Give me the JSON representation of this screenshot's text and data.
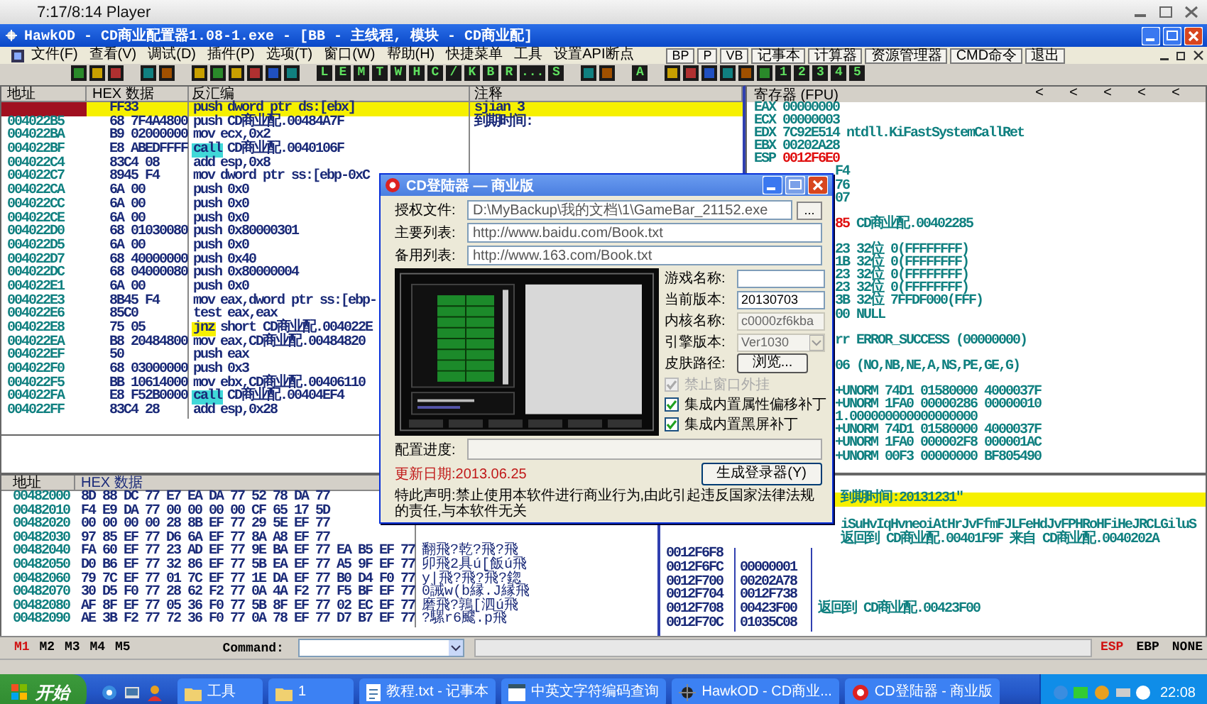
{
  "player": {
    "title": "7:17/8:14 Player"
  },
  "window": {
    "title": "HawkOD - CD商业配置器1.08-1.exe - [BB - 主线程, 模块 - CD商业配]"
  },
  "menu": [
    "文件(F)",
    "查看(V)",
    "调试(D)",
    "插件(P)",
    "选项(T)",
    "窗口(W)",
    "帮助(H)",
    "快捷菜单",
    "工具",
    "设置API断点"
  ],
  "tool_buttons": [
    "BP",
    "P",
    "VB",
    "记事本",
    "计算器",
    "资源管理器",
    "CMD命令",
    "退出"
  ],
  "toolbar": [
    {
      "kind": "icon"
    },
    {
      "kind": "icon"
    },
    {
      "kind": "icon"
    },
    {
      "kind": "gap"
    },
    {
      "kind": "icon"
    },
    {
      "kind": "icon"
    },
    {
      "kind": "gap"
    },
    {
      "kind": "icon"
    },
    {
      "kind": "icon"
    },
    {
      "kind": "icon"
    },
    {
      "kind": "icon"
    },
    {
      "kind": "icon"
    },
    {
      "kind": "icon"
    },
    {
      "kind": "gap"
    },
    {
      "kind": "letter",
      "label": "L"
    },
    {
      "kind": "letter",
      "label": "E"
    },
    {
      "kind": "letter",
      "label": "M"
    },
    {
      "kind": "letter",
      "label": "T"
    },
    {
      "kind": "letter",
      "label": "W"
    },
    {
      "kind": "letter",
      "label": "H"
    },
    {
      "kind": "letter",
      "label": "C"
    },
    {
      "kind": "letter",
      "label": "/"
    },
    {
      "kind": "letter",
      "label": "K"
    },
    {
      "kind": "letter",
      "label": "B"
    },
    {
      "kind": "letter",
      "label": "R"
    },
    {
      "kind": "letter",
      "label": "..."
    },
    {
      "kind": "letter",
      "label": "S"
    },
    {
      "kind": "gap"
    },
    {
      "kind": "icon"
    },
    {
      "kind": "icon"
    },
    {
      "kind": "gap"
    },
    {
      "kind": "letter",
      "label": "A"
    },
    {
      "kind": "gap"
    },
    {
      "kind": "icon"
    },
    {
      "kind": "icon"
    },
    {
      "kind": "icon"
    },
    {
      "kind": "icon"
    },
    {
      "kind": "icon"
    },
    {
      "kind": "icon"
    },
    {
      "kind": "letter",
      "label": "1"
    },
    {
      "kind": "letter",
      "label": "2"
    },
    {
      "kind": "letter",
      "label": "3"
    },
    {
      "kind": "letter",
      "label": "4"
    },
    {
      "kind": "letter",
      "label": "5"
    }
  ],
  "disassembly": {
    "columns": [
      "地址",
      "HEX 数据",
      "反汇编",
      "注释"
    ],
    "rows": [
      {
        "hex": "FF33",
        "op": "push",
        "args": "dword ptr ds:[ebx]",
        "kind": "plain",
        "comment": "sjian  3",
        "selected": true,
        "current": true
      },
      {
        "address": "004022B5",
        "hex": "68 7F4A4800",
        "op": "push",
        "args": "CD商业配.00484A7F",
        "kind": "plain",
        "comment": "到期时间:",
        "selected": false,
        "current": false
      },
      {
        "address": "004022BA",
        "hex": "B9 02000000",
        "op": "mov",
        "args": "ecx,0x2",
        "kind": "plain",
        "selected": false,
        "current": false
      },
      {
        "address": "004022BF",
        "hex": "E8 ABEDFFFF",
        "op": "call",
        "args": "CD商业配.0040106F",
        "kind": "call",
        "selected": false,
        "current": false
      },
      {
        "address": "004022C4",
        "hex": "83C4 08",
        "op": "add",
        "args": "esp,0x8",
        "kind": "plain",
        "selected": false,
        "current": false
      },
      {
        "address": "004022C7",
        "hex": "8945 F4",
        "op": "mov",
        "args": "dword ptr ss:[ebp-0xC",
        "kind": "plain",
        "selected": false,
        "current": false
      },
      {
        "address": "004022CA",
        "hex": "6A 00",
        "op": "push",
        "args": "0x0",
        "kind": "plain",
        "selected": false,
        "current": false
      },
      {
        "address": "004022CC",
        "hex": "6A 00",
        "op": "push",
        "args": "0x0",
        "kind": "plain",
        "selected": false,
        "current": false
      },
      {
        "address": "004022CE",
        "hex": "6A 00",
        "op": "push",
        "args": "0x0",
        "kind": "plain",
        "selected": false,
        "current": false
      },
      {
        "address": "004022D0",
        "hex": "68 01030080",
        "op": "push",
        "args": "0x80000301",
        "kind": "plain",
        "selected": false,
        "current": false
      },
      {
        "address": "004022D5",
        "hex": "6A 00",
        "op": "push",
        "args": "0x0",
        "kind": "plain",
        "selected": false,
        "current": false
      },
      {
        "address": "004022D7",
        "hex": "68 40000000",
        "op": "push",
        "args": "0x40",
        "kind": "plain",
        "selected": false,
        "current": false
      },
      {
        "address": "004022DC",
        "hex": "68 04000080",
        "op": "push",
        "args": "0x80000004",
        "kind": "plain",
        "selected": false,
        "current": false
      },
      {
        "address": "004022E1",
        "hex": "6A 00",
        "op": "push",
        "args": "0x0",
        "kind": "plain",
        "selected": false,
        "current": false
      },
      {
        "address": "004022E3",
        "hex": "8B45 F4",
        "op": "mov",
        "args": "eax,dword ptr ss:[ebp-",
        "kind": "plain",
        "selected": false,
        "current": false
      },
      {
        "address": "004022E6",
        "hex": "85C0",
        "op": "test",
        "args": "eax,eax",
        "kind": "plain",
        "selected": false,
        "current": false
      },
      {
        "address": "004022E8",
        "hex": "75 05",
        "op": "jnz",
        "args": "short CD商业配.004022E",
        "kind": "jump",
        "selected": false,
        "current": false
      },
      {
        "address": "004022EA",
        "hex": "B8 20484800",
        "op": "mov",
        "args": "eax,CD商业配.00484820",
        "kind": "plain",
        "selected": false,
        "current": false
      },
      {
        "address": "004022EF",
        "hex": "50",
        "op": "push",
        "args": "eax",
        "kind": "plain",
        "selected": false,
        "current": false
      },
      {
        "address": "004022F0",
        "hex": "68 03000000",
        "op": "push",
        "args": "0x3",
        "kind": "plain",
        "selected": false,
        "current": false
      },
      {
        "address": "004022F5",
        "hex": "BB 10614000",
        "op": "mov",
        "args": "ebx,CD商业配.00406110",
        "kind": "plain",
        "selected": false,
        "current": false
      },
      {
        "address": "004022FA",
        "hex": "E8 F52B0000",
        "op": "call",
        "args": "CD商业配.00404EF4",
        "kind": "call",
        "selected": false,
        "current": false
      },
      {
        "address": "004022FF",
        "hex": "83C4 28",
        "op": "add",
        "args": "esp,0x28",
        "kind": "plain",
        "selected": false,
        "current": false
      }
    ]
  },
  "registers": {
    "title": "寄存器 (FPU)",
    "header_buttons": [
      "<",
      "<",
      "<",
      "<",
      "<"
    ],
    "lines": [
      {
        "kind": "full",
        "name": "EAX",
        "value": "00000000",
        "alert": false
      },
      {
        "kind": "full",
        "name": "ECX",
        "value": "00000003",
        "alert": false
      },
      {
        "kind": "full",
        "name": "EDX",
        "value": "7C92E514",
        "note": "ntdll.KiFastSystemCallRet",
        "alert": false
      },
      {
        "kind": "full",
        "name": "EBX",
        "value": "00202A28",
        "alert": false
      },
      {
        "kind": "full",
        "name": "ESP",
        "value": "0012F6E0",
        "alert": true
      },
      {
        "kind": "covered",
        "value": "F4",
        "alert": false
      },
      {
        "kind": "covered",
        "value": "76",
        "alert": false
      },
      {
        "kind": "covered",
        "value": "07",
        "alert": false
      },
      {
        "kind": "gap"
      },
      {
        "kind": "covered",
        "value": "85",
        "note": "CD商业配.00402285",
        "alert": true
      },
      {
        "kind": "gap"
      },
      {
        "kind": "covered",
        "value": "23",
        "note": "32位  0(FFFFFFFF)",
        "alert": false
      },
      {
        "kind": "covered",
        "value": "1B",
        "note": "32位  0(FFFFFFFF)",
        "alert": false
      },
      {
        "kind": "covered",
        "value": "23",
        "note": "32位  0(FFFFFFFF)",
        "alert": false
      },
      {
        "kind": "covered",
        "value": "23",
        "note": "32位  0(FFFFFFFF)",
        "alert": false
      },
      {
        "kind": "covered",
        "value": "3B",
        "note": "32位  7FFDF000(FFF)",
        "alert": false
      },
      {
        "kind": "covered",
        "value": "00",
        "note": "NULL",
        "alert": false
      },
      {
        "kind": "gap"
      },
      {
        "kind": "covered",
        "value": "rr",
        "note": "ERROR_SUCCESS (00000000)",
        "alert": false
      },
      {
        "kind": "gap"
      },
      {
        "kind": "covered",
        "value": "06",
        "note": "(NO,NB,NE,A,NS,PE,GE,G)",
        "alert": false
      },
      {
        "kind": "gap"
      },
      {
        "kind": "covered",
        "value": "+UNORM",
        "note": "74D1 01580000 4000037F",
        "alert": false
      },
      {
        "kind": "covered",
        "value": "+UNORM",
        "note": "1FA0 00000286 00000010",
        "alert": false
      },
      {
        "kind": "covered",
        "value": "1.000000000000000000",
        "alert": false
      },
      {
        "kind": "covered",
        "value": "+UNORM",
        "note": "74D1 01580000 4000037F",
        "alert": false
      },
      {
        "kind": "covered",
        "value": "+UNORM",
        "note": "1FA0 000002F8 000001AC",
        "alert": false
      },
      {
        "kind": "covered",
        "value": "+UNORM",
        "note": "00F3 00000000 BF805490",
        "alert": false
      }
    ]
  },
  "dump": {
    "columns": [
      "地址",
      "HEX 数据"
    ],
    "rows": [
      {
        "address": "00482000",
        "hex": "8D 88 DC 77 E7 EA DA 77 52 78 DA 77"
      },
      {
        "address": "00482010",
        "hex": "F4 E9 DA 77 00 00 00 00 CF 65 17 5D"
      },
      {
        "address": "00482020",
        "hex": "00 00 00 00 28 8B EF 77 29 5E EF 77"
      },
      {
        "address": "00482030",
        "hex": "97 85 EF 77 D6 6A EF 77 8A A8 EF 77"
      },
      {
        "address": "00482040",
        "hex": "FA 60 EF 77 23 AD EF 77 9E BA EF 77 EA B5 EF 77",
        "ascii": "翻飛?乾?飛?飛"
      },
      {
        "address": "00482050",
        "hex": "D0 B6 EF 77 32 86 EF 77 5B EA EF 77 A5 9F EF 77",
        "ascii": "卯飛2具ú[飯ú飛"
      },
      {
        "address": "00482060",
        "hex": "79 7C EF 77 01 7C EF 77 1E DA EF 77 B0 D4 F0 77",
        "ascii": "y|飛?飛?飛?鍃"
      },
      {
        "address": "00482070",
        "hex": "30 D5 F0 77 28 62 F2 77 0A 4A F2 77 F5 BF EF 77",
        "ascii": "0誡w(b縁.J縁飛"
      },
      {
        "address": "00482080",
        "hex": "AF 8F EF 77 05 36 F0 77 5B 8F EF 77 02 EC EF 77",
        "ascii": "磨飛?鶉[泗ú飛"
      },
      {
        "address": "00482090",
        "hex": "AE 3B F2 77 72 36 F0 77 0A 78 EF 77 D7 B7 EF 77",
        "ascii": "?騾r6飂.p飛"
      }
    ]
  },
  "stack": {
    "rows": [
      {
        "kind": "covered",
        "selected": false
      },
      {
        "kind": "covered",
        "comment": "到期时间:20131231\"",
        "selected": true
      },
      {
        "kind": "covered",
        "selected": false
      },
      {
        "kind": "covered",
        "comment": "iSuHvIqHvneoiAtHrJvFfmFJLFeHdJvFPHRoHFiHeJRCLGiluS",
        "selected": false
      },
      {
        "kind": "covered",
        "comment": "返回到 CD商业配.00401F9F 来自 CD商业配.0040202A",
        "selected": false
      },
      {
        "kind": "full",
        "address": "0012F6F8",
        "selected": false
      },
      {
        "kind": "full",
        "address": "0012F6FC",
        "value": "00000001",
        "selected": false
      },
      {
        "kind": "full",
        "address": "0012F700",
        "value": "00202A78",
        "selected": false
      },
      {
        "kind": "full",
        "address": "0012F704",
        "value": "0012F738",
        "selected": false
      },
      {
        "kind": "full",
        "address": "0012F708",
        "value": "00423F00",
        "comment": "返回到 CD商业配.00423F00",
        "selected": false
      },
      {
        "kind": "full",
        "address": "0012F70C",
        "value": "01035C08",
        "selected": false
      }
    ]
  },
  "command_bar": {
    "marks": [
      {
        "label": "M1",
        "selected": true
      },
      {
        "label": "M2",
        "selected": false
      },
      {
        "label": "M3",
        "selected": false
      },
      {
        "label": "M4",
        "selected": false
      },
      {
        "label": "M5",
        "selected": false
      }
    ],
    "label": "Command:",
    "registers": [
      {
        "label": "ESP",
        "selected": true
      },
      {
        "label": "EBP",
        "selected": false
      },
      {
        "label": "NONE",
        "selected": false
      }
    ]
  },
  "dialog": {
    "title": "CD登陆器 — 商业版",
    "fields": [
      {
        "label": "授权文件:",
        "value": "D:\\MyBackup\\我的文档\\1\\GameBar_21152.exe",
        "browse": "..."
      },
      {
        "label": "主要列表:",
        "value": "http://www.baidu.com/Book.txt"
      },
      {
        "label": "备用列表:",
        "value": "http://www.163.com/Book.txt"
      }
    ],
    "side_fields": [
      {
        "kind": "input",
        "label": "游戏名称:",
        "disabled": false
      },
      {
        "kind": "input",
        "label": "当前版本:",
        "value": "20130703",
        "disabled": false
      },
      {
        "kind": "input",
        "label": "内核名称:",
        "value": "c0000zf6kba",
        "disabled": true
      },
      {
        "kind": "select",
        "label": "引擎版本:",
        "value": "Ver1030",
        "disabled": true
      },
      {
        "kind": "button",
        "label": "皮肤路径:",
        "button": "浏览..."
      }
    ],
    "checkboxes": [
      {
        "label": "禁止窗口外挂",
        "checked": true,
        "disabled": true
      },
      {
        "label": "集成内置属性偏移补丁",
        "checked": true,
        "disabled": false
      },
      {
        "label": "集成内置黑屏补丁",
        "checked": true,
        "disabled": false
      }
    ],
    "progress": {
      "label": "配置进度:",
      "level": 0
    },
    "update_date": "更新日期:2013.06.25",
    "generate_button": "生成登录器(Y)",
    "notice": "特此声明:禁止使用本软件进行商业行为,由此引起违反国家法律法规的责任,与本软件无关"
  },
  "taskbar": {
    "start": "开始",
    "tasks": [
      {
        "kind": "folder",
        "label": "工具"
      },
      {
        "kind": "folder",
        "label": "1"
      },
      {
        "kind": "notepad",
        "label": "教程.txt - 记事本"
      },
      {
        "kind": "app",
        "label": "中英文字符编码查询"
      },
      {
        "kind": "debugger",
        "label": "HawkOD - CD商业..."
      },
      {
        "kind": "launcher",
        "label": "CD登陆器 - 商业版"
      }
    ],
    "clock": "22:08"
  }
}
